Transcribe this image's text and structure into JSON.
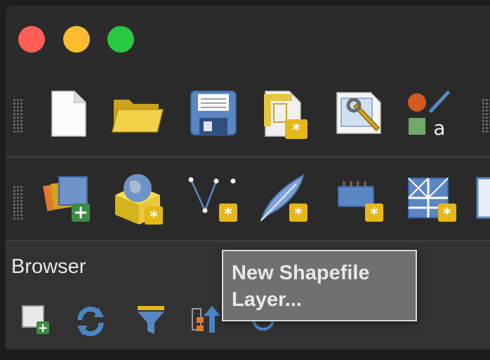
{
  "window": {
    "controls": [
      "close",
      "minimize",
      "zoom"
    ]
  },
  "toolbar_top": {
    "buttons": [
      {
        "icon": "new-project-icon"
      },
      {
        "icon": "open-project-icon"
      },
      {
        "icon": "save-project-icon"
      },
      {
        "icon": "new-print-layout-icon"
      },
      {
        "icon": "layout-manager-icon"
      },
      {
        "icon": "style-manager-icon"
      }
    ]
  },
  "toolbar_layers": {
    "buttons": [
      {
        "icon": "data-source-manager-icon"
      },
      {
        "icon": "new-geopackage-layer-icon"
      },
      {
        "icon": "new-shapefile-layer-icon"
      },
      {
        "icon": "new-spatialite-layer-icon"
      },
      {
        "icon": "new-temporary-scratch-layer-icon"
      },
      {
        "icon": "new-virtual-layer-icon"
      }
    ]
  },
  "browser": {
    "title": "Browser"
  },
  "tooltip": {
    "text": "New Shapefile Layer..."
  },
  "colors": {
    "close": "#fe5f57",
    "minimize": "#febc2e",
    "zoom": "#28c840",
    "toolbar_bg": "#2a2a2a",
    "panel_bg": "#323232",
    "tooltip_bg": "#707070",
    "asterisk_badge": "#e5b719"
  }
}
